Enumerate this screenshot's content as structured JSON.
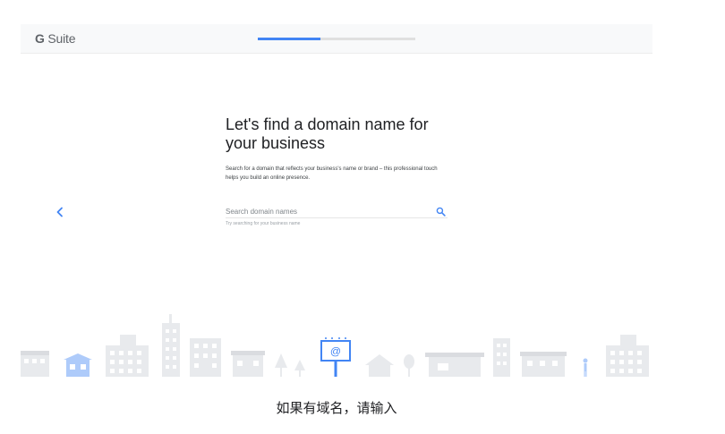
{
  "header": {
    "logo_g": "G",
    "logo_suite": "Suite",
    "progress_fraction": 0.4
  },
  "main": {
    "heading": "Let's find a domain name for your business",
    "description": "Search for a domain that reflects your business's name or brand – this professional touch helps you build an online presence.",
    "search": {
      "placeholder": "Search domain names",
      "value": "",
      "hint": "Try searching for your business name"
    }
  },
  "icons": {
    "back": "chevron-left-icon",
    "search": "search-icon",
    "billboard_symbol": "@"
  },
  "caption": "如果有域名，请输入",
  "colors": {
    "accent": "#4285f4",
    "skyline": "#e8eaed",
    "highlight_building": "#aecbfa",
    "text_primary": "#202124"
  }
}
